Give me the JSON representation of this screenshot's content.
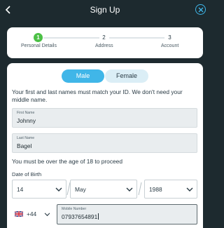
{
  "header": {
    "title": "Sign Up"
  },
  "stepper": {
    "steps": [
      {
        "number": "1",
        "label": "Personal Details"
      },
      {
        "number": "2",
        "label": "Address"
      },
      {
        "number": "3",
        "label": "Account"
      }
    ],
    "active_step": 1
  },
  "gender": {
    "male_label": "Male",
    "female_label": "Female",
    "selected": "Male"
  },
  "name_note": "Your first and last names must match your ID. We don't need your middle name.",
  "first_name": {
    "label": "First Name",
    "value": "Johnny"
  },
  "last_name": {
    "label": "Last Name",
    "value": "Bagel"
  },
  "age_note": "You must be over the age of 18 to proceed",
  "dob": {
    "label": "Date of Birth",
    "day": "14",
    "month": "May",
    "year": "1988"
  },
  "phone": {
    "country_code": "+44",
    "flag": "uk-flag-icon",
    "label": "Mobile Number",
    "value": "07937654891"
  },
  "colors": {
    "accent": "#40b6e8",
    "success": "#4cc046",
    "header_bg": "#1d2a2f"
  }
}
